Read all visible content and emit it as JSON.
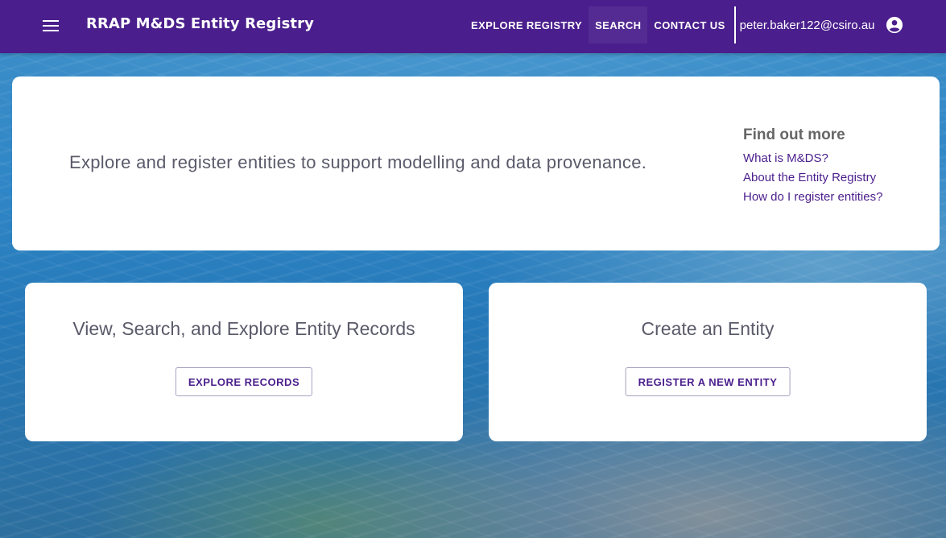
{
  "header": {
    "title": "RRAP M&DS Entity Registry",
    "menu_icon": "hamburger-menu-icon",
    "nav": [
      {
        "label": "EXPLORE REGISTRY"
      },
      {
        "label": "SEARCH"
      },
      {
        "label": "CONTACT US"
      }
    ],
    "user_email": "peter.baker122@csiro.au",
    "account_icon": "account-circle-icon"
  },
  "hero": {
    "tagline": "Explore and register entities to support modelling and data provenance.",
    "find_more": {
      "title": "Find out more",
      "links": [
        {
          "label": "What is M&DS?"
        },
        {
          "label": "About the Entity Registry"
        },
        {
          "label": "How do I register entities?"
        }
      ]
    }
  },
  "cards": [
    {
      "title": "View, Search, and Explore Entity Records",
      "button": "EXPLORE RECORDS"
    },
    {
      "title": "Create an Entity",
      "button": "REGISTER A NEW ENTITY"
    }
  ],
  "colors": {
    "brand": "#4a1e8c",
    "text_muted": "#5a5a6a"
  }
}
